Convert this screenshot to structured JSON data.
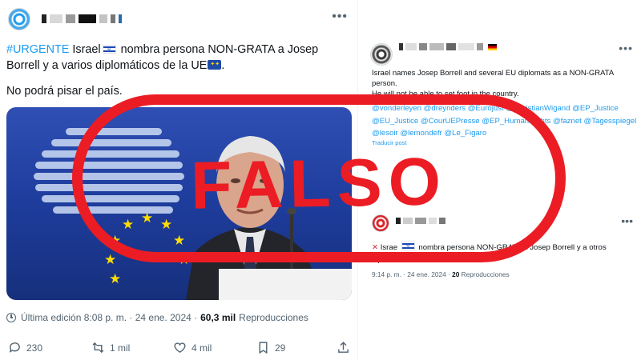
{
  "left_post": {
    "more_icon": "more-horizontal-icon",
    "hashtag": "#URGENTE",
    "text_part1": " Israel",
    "text_part2": " nombra persona NON-GRATA a Josep Borrell y a varios diplomáticos de la UE",
    "text_part3": ".",
    "line2": "No podrá pisar el país.",
    "meta_label": "Última edición 8:08 p. m. · 24 ene. 2024 · ",
    "meta_views": "60,3 mil",
    "meta_views_label": " Reproducciones",
    "actions": {
      "replies": "230",
      "reposts": "1 mil",
      "likes": "4 mil",
      "bookmarks": "29"
    }
  },
  "right_post": {
    "text_line1": "Israel names Josep Borrell and several EU diplomats as a NON-GRATA person.",
    "text_line2": "He will not be able to set foot in the country.",
    "mentions": "@vonderleyen @dreynders @Eurojust @ChristianWigand @EP_Justice @EU_Justice @CourUEPresse @EP_HumanRights @faznet @Tagesspiegel @lesoir @lemondefr @Le_Figaro",
    "translate": "Traducir post",
    "quote": {
      "text_part1": " Israe",
      "text_part2": " nombra persona NON-GRATA a Josep Borrell y a otros diplomáticos de la UE",
      "meta_time": "9:14 p. m. · 24 ene. 2024 · ",
      "meta_views": "20",
      "meta_views_label": " Reproducciones"
    }
  },
  "stamp": {
    "word": "FALSO",
    "color": "#ec1c24"
  }
}
